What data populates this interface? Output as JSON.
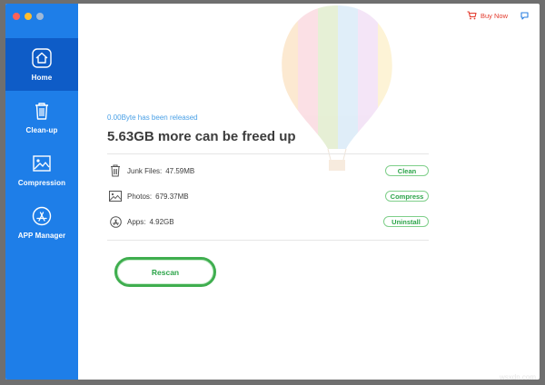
{
  "sidebar": {
    "items": [
      {
        "label": "Home",
        "icon": "home-icon",
        "active": true
      },
      {
        "label": "Clean-up",
        "icon": "trash-icon",
        "active": false
      },
      {
        "label": "Compression",
        "icon": "image-icon",
        "active": false
      },
      {
        "label": "APP Manager",
        "icon": "app-store-icon",
        "active": false
      }
    ]
  },
  "topbar": {
    "buy_now_label": "Buy Now"
  },
  "main": {
    "released_text": "0.00Byte has been released",
    "headline": "5.63GB more can be freed up",
    "rows": [
      {
        "icon": "trash-icon",
        "label": "Junk Files:",
        "value": "47.59MB",
        "button": "Clean"
      },
      {
        "icon": "image-icon",
        "label": "Photos:",
        "value": "679.37MB",
        "button": "Compress"
      },
      {
        "icon": "app-store-icon",
        "label": "Apps:",
        "value": "4.92GB",
        "button": "Uninstall"
      }
    ],
    "rescan_label": "Rescan"
  },
  "watermark": "wsxdn.com",
  "colors": {
    "sidebar_blue": "#1e7ee8",
    "sidebar_active": "#0e5cc7",
    "accent_green": "#2ca449",
    "buy_now_red": "#e33a2c",
    "released_blue": "#4aa0e6"
  }
}
